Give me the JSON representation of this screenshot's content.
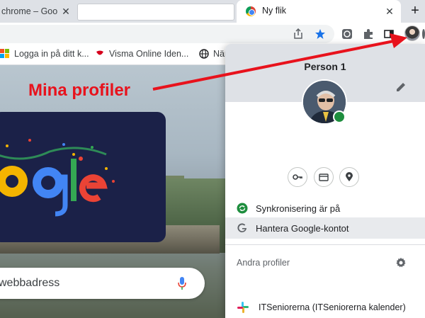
{
  "browser": {
    "tabs": [
      {
        "label": "chrome – Goo",
        "state": "inactive"
      },
      {
        "label": "",
        "state": "blank"
      },
      {
        "label": "Ny flik",
        "state": "active"
      }
    ],
    "new_tab_symbol": "+",
    "close_symbol": "✕"
  },
  "toolbar": {
    "icons": [
      "share-icon",
      "bookmark-star-icon",
      "extension-icon-1",
      "puzzle-extensions-icon",
      "side-panel-icon",
      "profile-avatar",
      "overflow-menu-icon"
    ],
    "accent": "#1a73e8"
  },
  "bookmarks": [
    {
      "label": "Logga in på ditt k...",
      "icon": "microsoft-logo-icon"
    },
    {
      "label": "Visma Online Iden...",
      "icon": "visma-logo-icon"
    },
    {
      "label": "När",
      "icon": "globe-icon"
    }
  ],
  "ntp": {
    "search_placeholder": "webbadress",
    "doodle_text": "Google"
  },
  "annotation": {
    "text": "Mina profiler",
    "color": "#e8121c"
  },
  "profile_menu": {
    "name": "Person 1",
    "quick_actions": [
      "key-icon",
      "payment-card-icon",
      "location-pin-icon"
    ],
    "sync_label": "Synkronisering är på",
    "manage_label": "Hantera Google-kontot",
    "other_profiles_label": "Andra profiler",
    "other_profiles": [
      {
        "label": "ITSeniorerna (ITSeniorerna kalender)",
        "icon": "slack-logo-icon"
      }
    ],
    "sync_color": "#1e8e3e"
  }
}
